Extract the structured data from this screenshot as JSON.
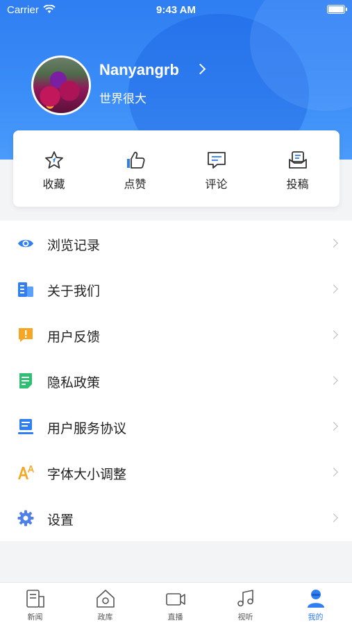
{
  "status_bar": {
    "carrier": "Carrier",
    "time": "9:43 AM"
  },
  "profile": {
    "username": "Nanyangrb",
    "motto": "世界很大"
  },
  "quick_actions": [
    {
      "label": "收藏",
      "icon": "star-icon"
    },
    {
      "label": "点赞",
      "icon": "thumbs-up-icon"
    },
    {
      "label": "评论",
      "icon": "comment-icon"
    },
    {
      "label": "投稿",
      "icon": "submit-icon"
    }
  ],
  "menu": [
    {
      "label": "浏览记录",
      "icon": "eye-icon",
      "color": "#2f7ef2"
    },
    {
      "label": "关于我们",
      "icon": "building-icon",
      "color": "#2f7ef2"
    },
    {
      "label": "用户反馈",
      "icon": "feedback-icon",
      "color": "#f5a623"
    },
    {
      "label": "隐私政策",
      "icon": "document-icon",
      "color": "#2fbf71"
    },
    {
      "label": "用户服务协议",
      "icon": "agreement-icon",
      "color": "#2f7ef2"
    },
    {
      "label": "字体大小调整",
      "icon": "font-size-icon",
      "color": "#f5a623"
    },
    {
      "label": "设置",
      "icon": "gear-icon",
      "color": "#2f7ef2"
    }
  ],
  "tabs": [
    {
      "label": "新闻",
      "icon": "news-icon",
      "active": false
    },
    {
      "label": "政库",
      "icon": "home-icon",
      "active": false
    },
    {
      "label": "直播",
      "icon": "video-icon",
      "active": false
    },
    {
      "label": "视听",
      "icon": "music-icon",
      "active": false
    },
    {
      "label": "我的",
      "icon": "user-icon",
      "active": true
    }
  ],
  "colors": {
    "primary": "#2f7ef2",
    "accent_orange": "#f5a623",
    "accent_green": "#2fbf71"
  }
}
